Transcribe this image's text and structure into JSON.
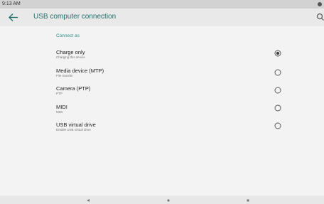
{
  "status_bar": {
    "time": "9:13 AM"
  },
  "app_bar": {
    "title": "USB computer connection",
    "back_icon": "arrow-left-icon",
    "search_icon": "search-icon"
  },
  "section": {
    "header": "Connect as"
  },
  "options": [
    {
      "title": "Charge only",
      "subtitle": "Charging this device",
      "selected": true
    },
    {
      "title": "Media device (MTP)",
      "subtitle": "File transfer",
      "selected": false
    },
    {
      "title": "Camera (PTP)",
      "subtitle": "PTP",
      "selected": false
    },
    {
      "title": "MIDI",
      "subtitle": "MIDI",
      "selected": false
    },
    {
      "title": "USB virtual drive",
      "subtitle": "Enable USB virtual drive",
      "selected": false
    }
  ],
  "nav_bar": {
    "back_icon": "back-triangle-icon",
    "home_icon": "home-circle-icon",
    "recents_icon": "recents-square-icon"
  },
  "colors": {
    "accent": "#2a8f86",
    "title": "#1f6f6a",
    "background": "#f3f3f3"
  }
}
